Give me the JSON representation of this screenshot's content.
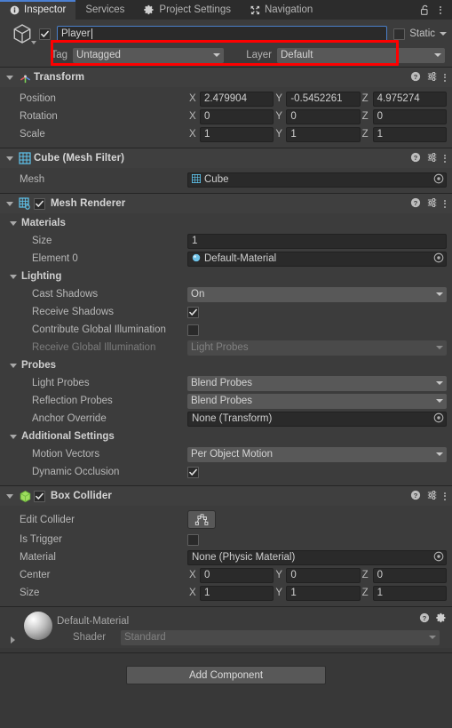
{
  "tabbar": {
    "tabs": [
      {
        "label": "Inspector",
        "icon": "info-icon",
        "active": true
      },
      {
        "label": "Services",
        "icon": "",
        "active": false
      },
      {
        "label": "Project Settings",
        "icon": "gear-icon",
        "active": false
      },
      {
        "label": "Navigation",
        "icon": "navigation-icon",
        "active": false
      }
    ],
    "lock_icon": "lock-open-icon",
    "menu_icon": "kebab-menu-icon"
  },
  "gameobject": {
    "enabled": true,
    "icon": "cube-icon",
    "name_value": "Player",
    "static_label": "Static",
    "static_checked": false,
    "tag_label": "Tag",
    "tag_value": "Untagged",
    "layer_label": "Layer",
    "layer_value": "Default",
    "highlight_color": "#fe0000"
  },
  "components": [
    {
      "title": "Transform",
      "icon": "transform-icon",
      "has_checkbox": false,
      "rows": [
        {
          "label": "Position",
          "type": "vec3",
          "x": "2.479904",
          "y": "-0.5452261",
          "z": "4.975274"
        },
        {
          "label": "Rotation",
          "type": "vec3",
          "x": "0",
          "y": "0",
          "z": "0"
        },
        {
          "label": "Scale",
          "type": "vec3",
          "x": "1",
          "y": "1",
          "z": "1"
        }
      ]
    },
    {
      "title": "Cube (Mesh Filter)",
      "icon": "mesh-filter-icon",
      "has_checkbox": false,
      "rows": [
        {
          "label": "Mesh",
          "type": "object",
          "value": "Cube",
          "value_icon": "mesh-icon"
        }
      ]
    },
    {
      "title": "Mesh Renderer",
      "icon": "mesh-renderer-icon",
      "has_checkbox": true,
      "checked": true,
      "sections": [
        {
          "name": "Materials",
          "rows": [
            {
              "label": "Size",
              "type": "text",
              "value": "1"
            },
            {
              "label": "Element 0",
              "type": "object",
              "value": "Default-Material",
              "value_icon": "material-icon"
            }
          ]
        },
        {
          "name": "Lighting",
          "rows": [
            {
              "label": "Cast Shadows",
              "type": "dropdown",
              "value": "On"
            },
            {
              "label": "Receive Shadows",
              "type": "checkbox",
              "checked": true
            },
            {
              "label": "Contribute Global Illumination",
              "type": "checkbox",
              "checked": false
            },
            {
              "label": "Receive Global Illumination",
              "type": "dropdown",
              "value": "Light Probes",
              "disabled": true
            }
          ]
        },
        {
          "name": "Probes",
          "rows": [
            {
              "label": "Light Probes",
              "type": "dropdown",
              "value": "Blend Probes"
            },
            {
              "label": "Reflection Probes",
              "type": "dropdown",
              "value": "Blend Probes"
            },
            {
              "label": "Anchor Override",
              "type": "object",
              "value": "None (Transform)"
            }
          ]
        },
        {
          "name": "Additional Settings",
          "rows": [
            {
              "label": "Motion Vectors",
              "type": "dropdown",
              "value": "Per Object Motion"
            },
            {
              "label": "Dynamic Occlusion",
              "type": "checkbox",
              "checked": true
            }
          ]
        }
      ]
    },
    {
      "title": "Box Collider",
      "icon": "box-collider-icon",
      "has_checkbox": true,
      "checked": true,
      "rows": [
        {
          "label": "Edit Collider",
          "type": "button",
          "button_icon": "edit-collider-icon"
        },
        {
          "label": "Is Trigger",
          "type": "checkbox",
          "checked": false
        },
        {
          "label": "Material",
          "type": "object",
          "value": "None (Physic Material)"
        },
        {
          "label": "Center",
          "type": "vec3",
          "x": "0",
          "y": "0",
          "z": "0"
        },
        {
          "label": "Size",
          "type": "vec3",
          "x": "1",
          "y": "1",
          "z": "1"
        }
      ]
    }
  ],
  "material_preview": {
    "name": "Default-Material",
    "shader_label": "Shader",
    "shader_value": "Standard",
    "help_icon": "help-icon",
    "settings_icon": "gear-icon"
  },
  "add_component": {
    "label": "Add Component"
  },
  "component_header_icons": {
    "help": "help-icon",
    "preset": "preset-icon",
    "menu": "kebab-menu-icon"
  },
  "axis_labels": {
    "x": "X",
    "y": "Y",
    "z": "Z"
  }
}
